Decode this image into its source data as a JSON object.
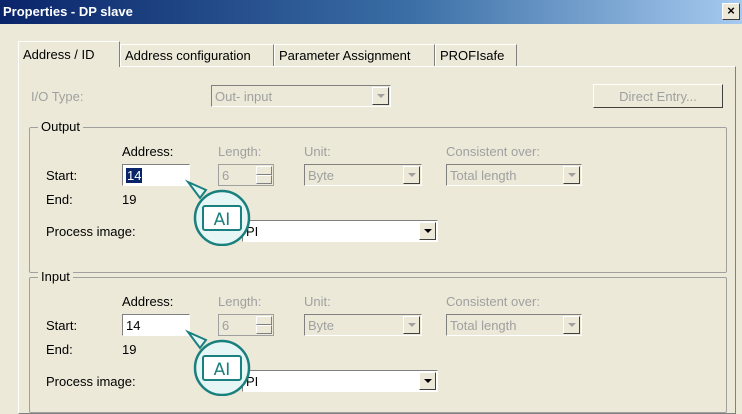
{
  "window": {
    "title": "Properties - DP slave",
    "close_label": "×"
  },
  "tabs": [
    {
      "label": "Address / ID"
    },
    {
      "label": "Address configuration"
    },
    {
      "label": "Parameter Assignment"
    },
    {
      "label": "PROFIsafe"
    }
  ],
  "io_type": {
    "label": "I/O Type:",
    "value": "Out- input"
  },
  "direct_entry_button": "Direct Entry...",
  "output": {
    "title": "Output",
    "address_header": "Address:",
    "length_header": "Length:",
    "unit_header": "Unit:",
    "consistent_header": "Consistent over:",
    "start_label": "Start:",
    "start_value": "14",
    "length_value": "6",
    "unit_value": "Byte",
    "consistent_value": "Total length",
    "end_label": "End:",
    "end_value": "19",
    "process_image_label": "Process image:",
    "process_image_value": "PI"
  },
  "input": {
    "title": "Input",
    "address_header": "Address:",
    "length_header": "Length:",
    "unit_header": "Unit:",
    "consistent_header": "Consistent over:",
    "start_label": "Start:",
    "start_value": "14",
    "length_value": "6",
    "unit_value": "Byte",
    "consistent_value": "Total length",
    "end_label": "End:",
    "end_value": "19",
    "process_image_label": "Process image:",
    "process_image_value": "PI"
  },
  "cursor": {
    "glyph": "AI",
    "color": "#1a7f7f",
    "fill": "#e6f6f4"
  }
}
